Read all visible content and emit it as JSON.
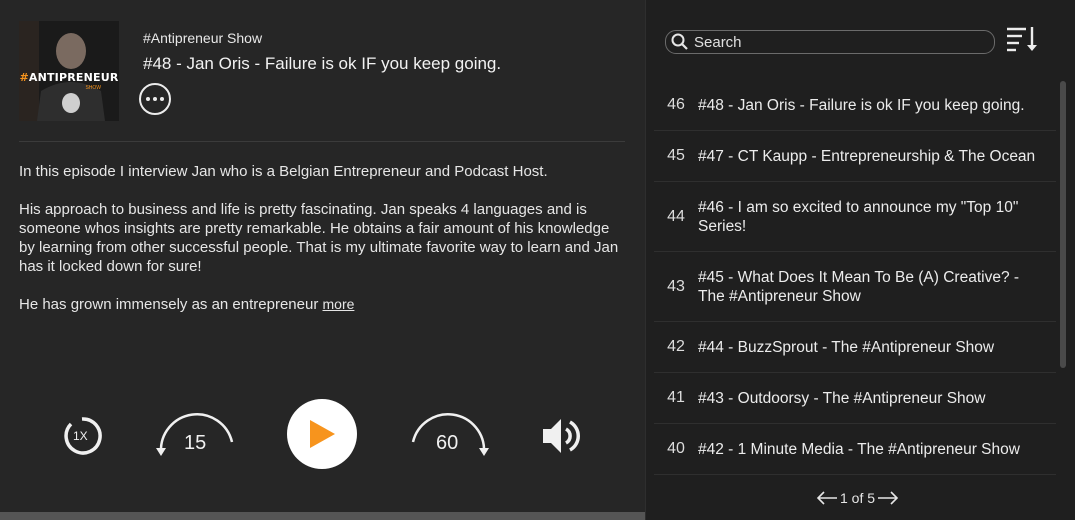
{
  "podcast": {
    "show_name": "#Antipreneur Show",
    "cover_text_hash": "#",
    "cover_text_word": "ANTIPRENEUR",
    "cover_sub": "SHOW"
  },
  "episode": {
    "title": "#48 - Jan Oris - Failure is ok IF you keep going.",
    "description": [
      "In this episode I interview Jan who is a Belgian Entrepreneur and Podcast Host.",
      "His approach to business and life is pretty fascinating. Jan speaks 4 languages and is someone whos insights are pretty remarkable. He obtains a fair amount of his knowledge by learning from other successful people. That is my ultimate favorite way to learn and Jan has it locked down for sure!",
      "He has grown  immensely as an entrepreneur"
    ],
    "more_label": "more"
  },
  "player": {
    "speed_label": "1X",
    "rewind_seconds": "15",
    "forward_seconds": "60",
    "progress": 0.0
  },
  "search": {
    "placeholder": "Search"
  },
  "episodes": [
    {
      "number": "46",
      "title": "#48 - Jan Oris - Failure is ok IF you keep going."
    },
    {
      "number": "45",
      "title": "#47 - CT Kaupp - Entrepreneurship & The Ocean"
    },
    {
      "number": "44",
      "title": "#46 - I am so excited to announce my \"Top 10\" Series!"
    },
    {
      "number": "43",
      "title": "#45 - What Does It Mean To Be (A) Creative? - The #Antipreneur Show"
    },
    {
      "number": "42",
      "title": "#44 - BuzzSprout - The #Antipreneur Show"
    },
    {
      "number": "41",
      "title": "#43 - Outdoorsy - The #Antipreneur Show"
    },
    {
      "number": "40",
      "title": "#42 - 1 Minute Media - The #Antipreneur Show"
    }
  ],
  "pagination": {
    "label": "1 of 5"
  },
  "colors": {
    "accent": "#f7941d",
    "play_bg": "#ffffff"
  }
}
